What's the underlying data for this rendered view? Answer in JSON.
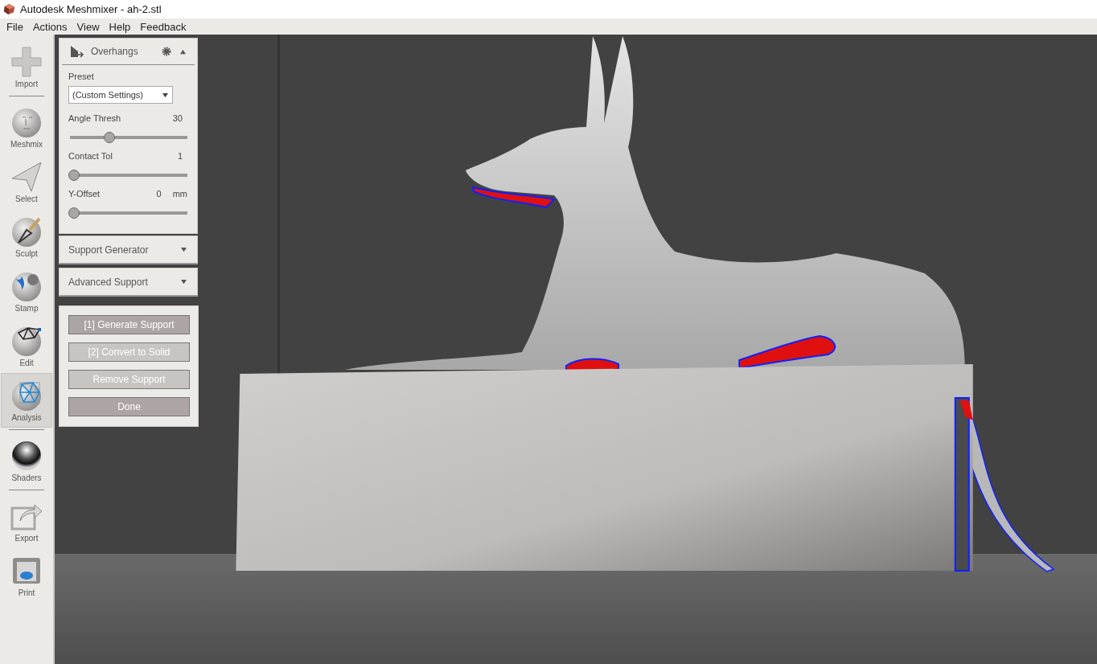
{
  "window": {
    "title": "Autodesk Meshmixer - ah-2.stl"
  },
  "menu": [
    "File",
    "Actions",
    "View",
    "Help",
    "Feedback"
  ],
  "toolbar": [
    {
      "label": "Import",
      "kind": "import",
      "selected": false,
      "separator_after": true
    },
    {
      "label": "Meshmix",
      "kind": "meshmix",
      "selected": false,
      "separator_after": false
    },
    {
      "label": "Select",
      "kind": "select",
      "selected": false,
      "separator_after": false
    },
    {
      "label": "Sculpt",
      "kind": "sculpt",
      "selected": false,
      "separator_after": false
    },
    {
      "label": "Stamp",
      "kind": "stamp",
      "selected": false,
      "separator_after": false
    },
    {
      "label": "Edit",
      "kind": "edit",
      "selected": false,
      "separator_after": false
    },
    {
      "label": "Analysis",
      "kind": "analysis",
      "selected": true,
      "separator_after": true
    },
    {
      "label": "Shaders",
      "kind": "shaders",
      "selected": false,
      "separator_after": true
    },
    {
      "label": "Export",
      "kind": "export",
      "selected": false,
      "separator_after": false
    },
    {
      "label": "Print",
      "kind": "print",
      "selected": false,
      "separator_after": false
    }
  ],
  "panel": {
    "title": "Overhangs",
    "expanded": true,
    "preset_label": "Preset",
    "preset_value": "(Custom Settings)",
    "sliders": [
      {
        "label": "Angle Thresh",
        "value": "30",
        "level": 0.32
      },
      {
        "label": "Contact Tol",
        "value": "1",
        "level": 0.0
      },
      {
        "label": "Y-Offset",
        "value": "0",
        "unit": "mm",
        "level": 0.0
      }
    ]
  },
  "sections": [
    {
      "title": "Support Generator",
      "expanded": false
    },
    {
      "title": "Advanced Support",
      "expanded": false
    }
  ],
  "actions": [
    {
      "label": "[1] Generate Support",
      "kind": "accent"
    },
    {
      "label": "[2] Convert to Solid",
      "kind": "plain"
    },
    {
      "label": "Remove Support",
      "kind": "plain"
    },
    {
      "label": "Done",
      "kind": "accent"
    }
  ]
}
